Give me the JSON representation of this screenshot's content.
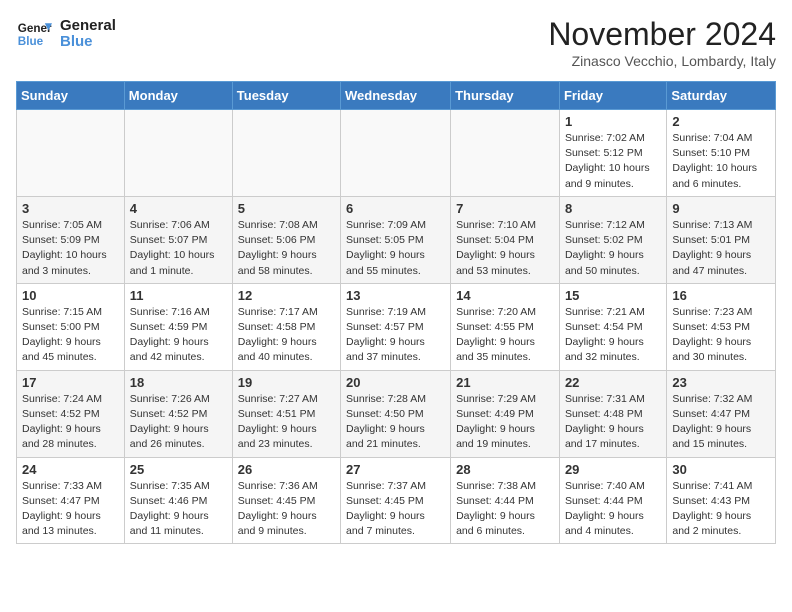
{
  "header": {
    "logo_line1": "General",
    "logo_line2": "Blue",
    "title": "November 2024",
    "location": "Zinasco Vecchio, Lombardy, Italy"
  },
  "days_of_week": [
    "Sunday",
    "Monday",
    "Tuesday",
    "Wednesday",
    "Thursday",
    "Friday",
    "Saturday"
  ],
  "weeks": [
    [
      {
        "day": "",
        "info": ""
      },
      {
        "day": "",
        "info": ""
      },
      {
        "day": "",
        "info": ""
      },
      {
        "day": "",
        "info": ""
      },
      {
        "day": "",
        "info": ""
      },
      {
        "day": "1",
        "info": "Sunrise: 7:02 AM\nSunset: 5:12 PM\nDaylight: 10 hours and 9 minutes."
      },
      {
        "day": "2",
        "info": "Sunrise: 7:04 AM\nSunset: 5:10 PM\nDaylight: 10 hours and 6 minutes."
      }
    ],
    [
      {
        "day": "3",
        "info": "Sunrise: 7:05 AM\nSunset: 5:09 PM\nDaylight: 10 hours and 3 minutes."
      },
      {
        "day": "4",
        "info": "Sunrise: 7:06 AM\nSunset: 5:07 PM\nDaylight: 10 hours and 1 minute."
      },
      {
        "day": "5",
        "info": "Sunrise: 7:08 AM\nSunset: 5:06 PM\nDaylight: 9 hours and 58 minutes."
      },
      {
        "day": "6",
        "info": "Sunrise: 7:09 AM\nSunset: 5:05 PM\nDaylight: 9 hours and 55 minutes."
      },
      {
        "day": "7",
        "info": "Sunrise: 7:10 AM\nSunset: 5:04 PM\nDaylight: 9 hours and 53 minutes."
      },
      {
        "day": "8",
        "info": "Sunrise: 7:12 AM\nSunset: 5:02 PM\nDaylight: 9 hours and 50 minutes."
      },
      {
        "day": "9",
        "info": "Sunrise: 7:13 AM\nSunset: 5:01 PM\nDaylight: 9 hours and 47 minutes."
      }
    ],
    [
      {
        "day": "10",
        "info": "Sunrise: 7:15 AM\nSunset: 5:00 PM\nDaylight: 9 hours and 45 minutes."
      },
      {
        "day": "11",
        "info": "Sunrise: 7:16 AM\nSunset: 4:59 PM\nDaylight: 9 hours and 42 minutes."
      },
      {
        "day": "12",
        "info": "Sunrise: 7:17 AM\nSunset: 4:58 PM\nDaylight: 9 hours and 40 minutes."
      },
      {
        "day": "13",
        "info": "Sunrise: 7:19 AM\nSunset: 4:57 PM\nDaylight: 9 hours and 37 minutes."
      },
      {
        "day": "14",
        "info": "Sunrise: 7:20 AM\nSunset: 4:55 PM\nDaylight: 9 hours and 35 minutes."
      },
      {
        "day": "15",
        "info": "Sunrise: 7:21 AM\nSunset: 4:54 PM\nDaylight: 9 hours and 32 minutes."
      },
      {
        "day": "16",
        "info": "Sunrise: 7:23 AM\nSunset: 4:53 PM\nDaylight: 9 hours and 30 minutes."
      }
    ],
    [
      {
        "day": "17",
        "info": "Sunrise: 7:24 AM\nSunset: 4:52 PM\nDaylight: 9 hours and 28 minutes."
      },
      {
        "day": "18",
        "info": "Sunrise: 7:26 AM\nSunset: 4:52 PM\nDaylight: 9 hours and 26 minutes."
      },
      {
        "day": "19",
        "info": "Sunrise: 7:27 AM\nSunset: 4:51 PM\nDaylight: 9 hours and 23 minutes."
      },
      {
        "day": "20",
        "info": "Sunrise: 7:28 AM\nSunset: 4:50 PM\nDaylight: 9 hours and 21 minutes."
      },
      {
        "day": "21",
        "info": "Sunrise: 7:29 AM\nSunset: 4:49 PM\nDaylight: 9 hours and 19 minutes."
      },
      {
        "day": "22",
        "info": "Sunrise: 7:31 AM\nSunset: 4:48 PM\nDaylight: 9 hours and 17 minutes."
      },
      {
        "day": "23",
        "info": "Sunrise: 7:32 AM\nSunset: 4:47 PM\nDaylight: 9 hours and 15 minutes."
      }
    ],
    [
      {
        "day": "24",
        "info": "Sunrise: 7:33 AM\nSunset: 4:47 PM\nDaylight: 9 hours and 13 minutes."
      },
      {
        "day": "25",
        "info": "Sunrise: 7:35 AM\nSunset: 4:46 PM\nDaylight: 9 hours and 11 minutes."
      },
      {
        "day": "26",
        "info": "Sunrise: 7:36 AM\nSunset: 4:45 PM\nDaylight: 9 hours and 9 minutes."
      },
      {
        "day": "27",
        "info": "Sunrise: 7:37 AM\nSunset: 4:45 PM\nDaylight: 9 hours and 7 minutes."
      },
      {
        "day": "28",
        "info": "Sunrise: 7:38 AM\nSunset: 4:44 PM\nDaylight: 9 hours and 6 minutes."
      },
      {
        "day": "29",
        "info": "Sunrise: 7:40 AM\nSunset: 4:44 PM\nDaylight: 9 hours and 4 minutes."
      },
      {
        "day": "30",
        "info": "Sunrise: 7:41 AM\nSunset: 4:43 PM\nDaylight: 9 hours and 2 minutes."
      }
    ]
  ]
}
